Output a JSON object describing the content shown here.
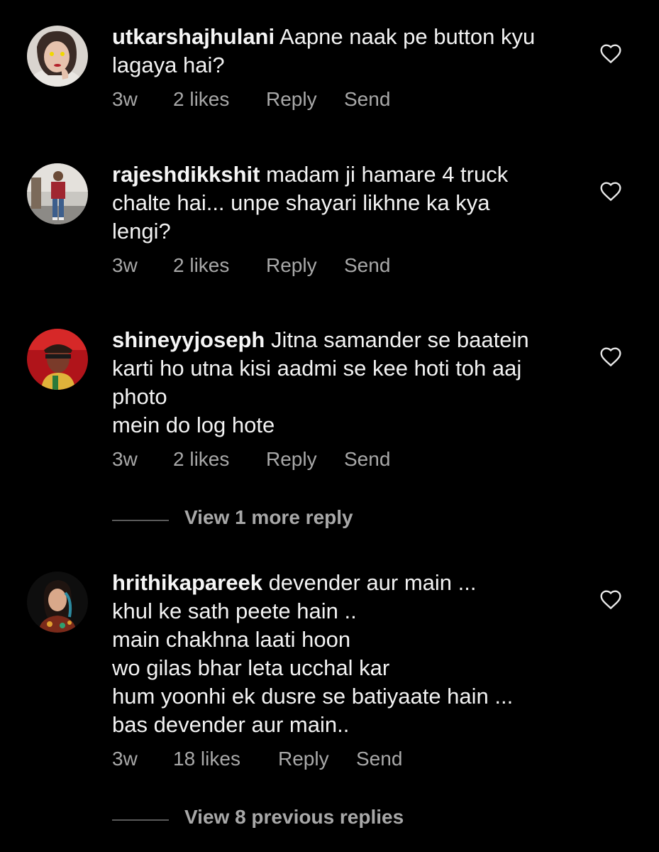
{
  "comments": [
    {
      "username": "utkarshajhulani",
      "lines": [
        "Aapne naak pe button kyu",
        "lagaya hai?"
      ],
      "time": "3w",
      "likes": "2 likes",
      "reply": "Reply",
      "send": "Send"
    },
    {
      "username": "rajeshdikkshit",
      "lines": [
        "madam ji hamare 4 truck",
        "chalte hai... unpe shayari likhne ka kya",
        "lengi?"
      ],
      "time": "3w",
      "likes": "2 likes",
      "reply": "Reply",
      "send": "Send"
    },
    {
      "username": "shineyyjoseph",
      "lines": [
        "Jitna samander se baatein",
        "karti ho utna kisi aadmi se kee hoti toh aaj",
        "photo",
        "mein do log hote"
      ],
      "time": "3w",
      "likes": "2 likes",
      "reply": "Reply",
      "send": "Send",
      "view_replies": "View 1 more reply"
    },
    {
      "username": "hrithikapareek",
      "lines": [
        "devender aur main ...",
        "khul ke sath peete hain ..",
        "main chakhna laati hoon",
        "wo gilas bhar leta ucchal kar",
        "hum yoonhi ek dusre se batiyaate hain ...",
        "bas devender aur main.."
      ],
      "time": "3w",
      "likes": "18 likes",
      "reply": "Reply",
      "send": "Send",
      "view_replies": "View 8 previous replies"
    }
  ],
  "icons": {
    "like": "heart-outline-icon"
  },
  "colors": {
    "background": "#000000",
    "primary_text": "#f5f5f5",
    "secondary_text": "#a8a8a8"
  }
}
